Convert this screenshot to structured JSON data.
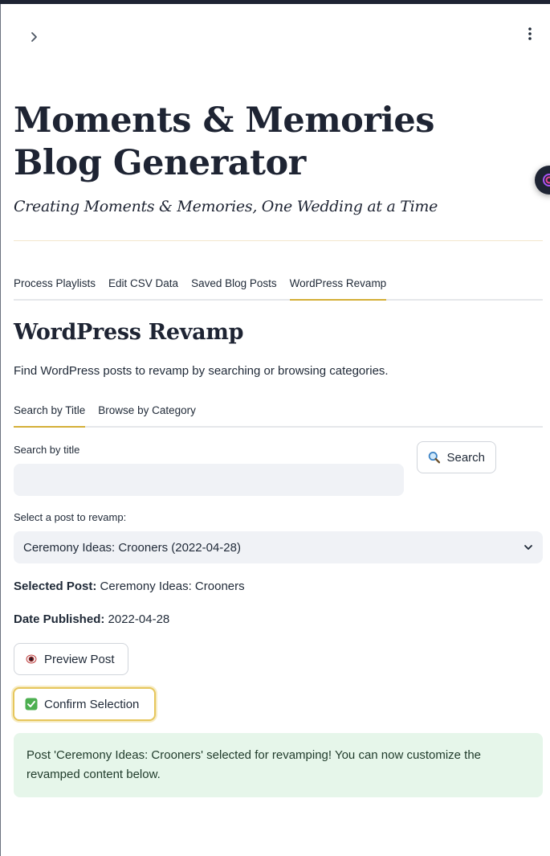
{
  "app": {
    "title": "Moments & Memories Blog Generator",
    "subtitle": "Creating Moments & Memories, One Wedding at a Time"
  },
  "icons": {
    "expand": "chevron-right-icon",
    "menu": "kebab-menu-icon",
    "search": "magnifier-icon",
    "preview": "eye-icon",
    "confirm": "check-box-icon"
  },
  "colors": {
    "navy": "#1e2433",
    "gold_accent": "#d4af37",
    "input_bg": "#f0f2f6",
    "success_bg": "#e6f6ea"
  },
  "main_tabs": [
    {
      "label": "Process Playlists",
      "active": false
    },
    {
      "label": "Edit CSV Data",
      "active": false
    },
    {
      "label": "Saved Blog Posts",
      "active": false
    },
    {
      "label": "WordPress Revamp",
      "active": true
    }
  ],
  "section": {
    "heading": "WordPress Revamp",
    "description": "Find WordPress posts to revamp by searching or browsing categories."
  },
  "sub_tabs": [
    {
      "label": "Search by Title",
      "active": true
    },
    {
      "label": "Browse by Category",
      "active": false
    }
  ],
  "search": {
    "label": "Search by title",
    "value": "",
    "placeholder": "",
    "button_label": "Search"
  },
  "post_select": {
    "label": "Select a post to revamp:",
    "selected": "Ceremony Ideas: Crooners (2022-04-28)"
  },
  "selected_post": {
    "post_label": "Selected Post:",
    "post_value": "Ceremony Ideas: Crooners",
    "date_label": "Date Published:",
    "date_value": "2022-04-28"
  },
  "buttons": {
    "preview_label": "Preview Post",
    "confirm_label": "Confirm Selection"
  },
  "alert": {
    "message": "Post 'Ceremony Ideas: Crooners' selected for revamping! You can now customize the revamped content below."
  }
}
